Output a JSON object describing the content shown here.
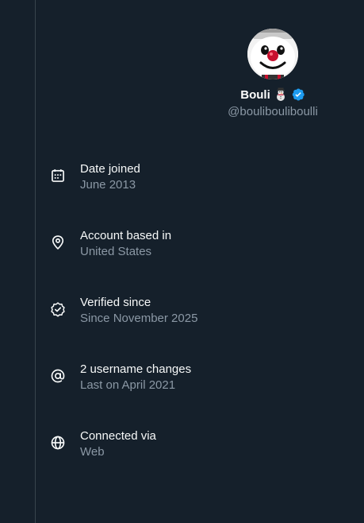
{
  "profile": {
    "display_name": "Bouli",
    "name_emoji": "snowman-emoji",
    "verified_icon": "verified-badge-icon",
    "handle": "@boulibouliboulli"
  },
  "info": [
    {
      "icon": "calendar-icon",
      "label": "Date joined",
      "value": "June 2013"
    },
    {
      "icon": "location-pin-icon",
      "label": "Account based in",
      "value": "United States"
    },
    {
      "icon": "verified-check-icon",
      "label": "Verified since",
      "value": "Since November 2025"
    },
    {
      "icon": "at-sign-icon",
      "label": "2 username changes",
      "value": "Last on April 2021"
    },
    {
      "icon": "globe-icon",
      "label": "Connected via",
      "value": "Web"
    }
  ],
  "colors": {
    "background": "#15202b",
    "primary_text": "#f7f9f9",
    "secondary_text": "#8b98a5",
    "verified_blue": "#1d9bf0",
    "border": "#38444d"
  }
}
